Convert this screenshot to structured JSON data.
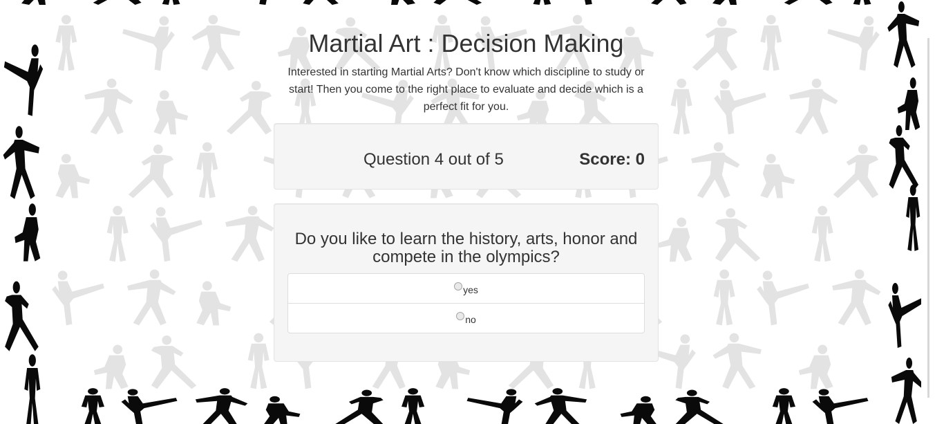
{
  "page": {
    "title": "Martial Art : Decision Making",
    "intro": "Interested in starting Martial Arts? Don't know which discipline to study or start! Then you come to the right place to evaluate and decide which is a perfect fit for you."
  },
  "status": {
    "question_counter": "Question 4 out of 5",
    "score": "Score: 0"
  },
  "question": {
    "text": "Do you like to learn the history, arts, honor and compete in the olympics?",
    "answers": [
      {
        "label": "yes"
      },
      {
        "label": "no"
      }
    ]
  },
  "colors": {
    "silhouette_dark": "#0a0a0a",
    "silhouette_light": "#e3e3e3",
    "panel_bg": "#f5f5f5"
  }
}
